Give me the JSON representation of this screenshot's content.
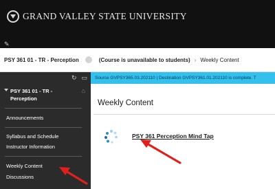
{
  "banner": {
    "logo_text": "GRAND VALLEY STATE UNIVERSITY"
  },
  "breadcrumb": {
    "course": "PSY 361 01 - TR - Perception",
    "availability": "(Course is unavailable to students)",
    "separator": "›",
    "page": "Weekly Content"
  },
  "sidebar": {
    "course_name": "PSY 361 01 - TR - Perception",
    "items": [
      {
        "label": "Announcements"
      },
      {
        "label": "Syllabus and Schedule"
      },
      {
        "label": "Instructor Information"
      },
      {
        "label": "Weekly Content"
      },
      {
        "label": "Discussions"
      }
    ]
  },
  "status_message": "Source GVPSY365.03.202110 | Destination GVPSY361.01.202110 is complete. T",
  "main": {
    "title": "Weekly Content",
    "items": [
      {
        "label": "PSY 361 Perception Mind Tap",
        "icon": "mindtap-icon"
      }
    ]
  },
  "colors": {
    "banner": "#111111",
    "sidebar": "#2b2b2b",
    "status_bar": "#34c0ed",
    "annotation": "#e0201c"
  }
}
